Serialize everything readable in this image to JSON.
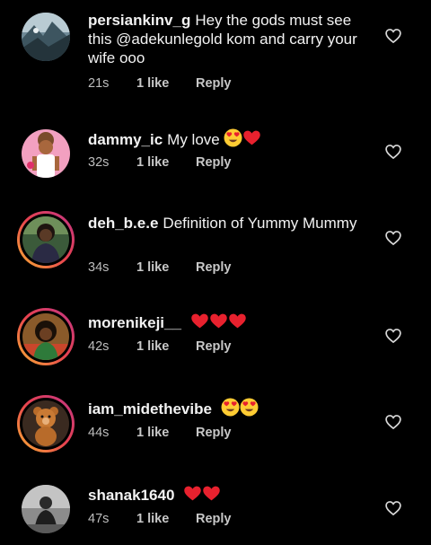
{
  "comments": [
    {
      "username": "persiankinv_g",
      "text": "Hey the gods must see this @adekunlegold kom and carry your wife ooo",
      "emojis": [],
      "time": "21s",
      "likes": "1 like",
      "reply": "Reply",
      "avatar_icon": "landscape-avatar"
    },
    {
      "username": "dammy_ic",
      "text": "My love",
      "emojis": [
        "heart-eyes-emoji",
        "red-heart-emoji"
      ],
      "time": "32s",
      "likes": "1 like",
      "reply": "Reply",
      "avatar_icon": "person-pink-avatar"
    },
    {
      "username": "deh_b.e.e",
      "text": "Definition of Yummy Mummy",
      "emojis": [],
      "time": "34s",
      "likes": "1 like",
      "reply": "Reply",
      "avatar_icon": "person-story-avatar"
    },
    {
      "username": "morenikeji__",
      "text": "",
      "emojis": [
        "red-heart-emoji",
        "red-heart-emoji",
        "red-heart-emoji"
      ],
      "time": "42s",
      "likes": "1 like",
      "reply": "Reply",
      "avatar_icon": "person-story-avatar"
    },
    {
      "username": "iam_midethevibe",
      "text": "",
      "emojis": [
        "heart-eyes-emoji",
        "heart-eyes-emoji"
      ],
      "time": "44s",
      "likes": "1 like",
      "reply": "Reply",
      "avatar_icon": "teddy-bear-avatar"
    },
    {
      "username": "shanak1640",
      "text": "",
      "emojis": [
        "red-heart-emoji",
        "red-heart-emoji"
      ],
      "time": "47s",
      "likes": "1 like",
      "reply": "Reply",
      "avatar_icon": "person-bw-avatar"
    }
  ],
  "like_icon": "heart-outline-icon",
  "colors": {
    "background": "#000000",
    "text": "#f2f2f2",
    "meta": "#bdbdbd",
    "story_ring": [
      "#f9b233",
      "#e8424f",
      "#c13584"
    ]
  }
}
